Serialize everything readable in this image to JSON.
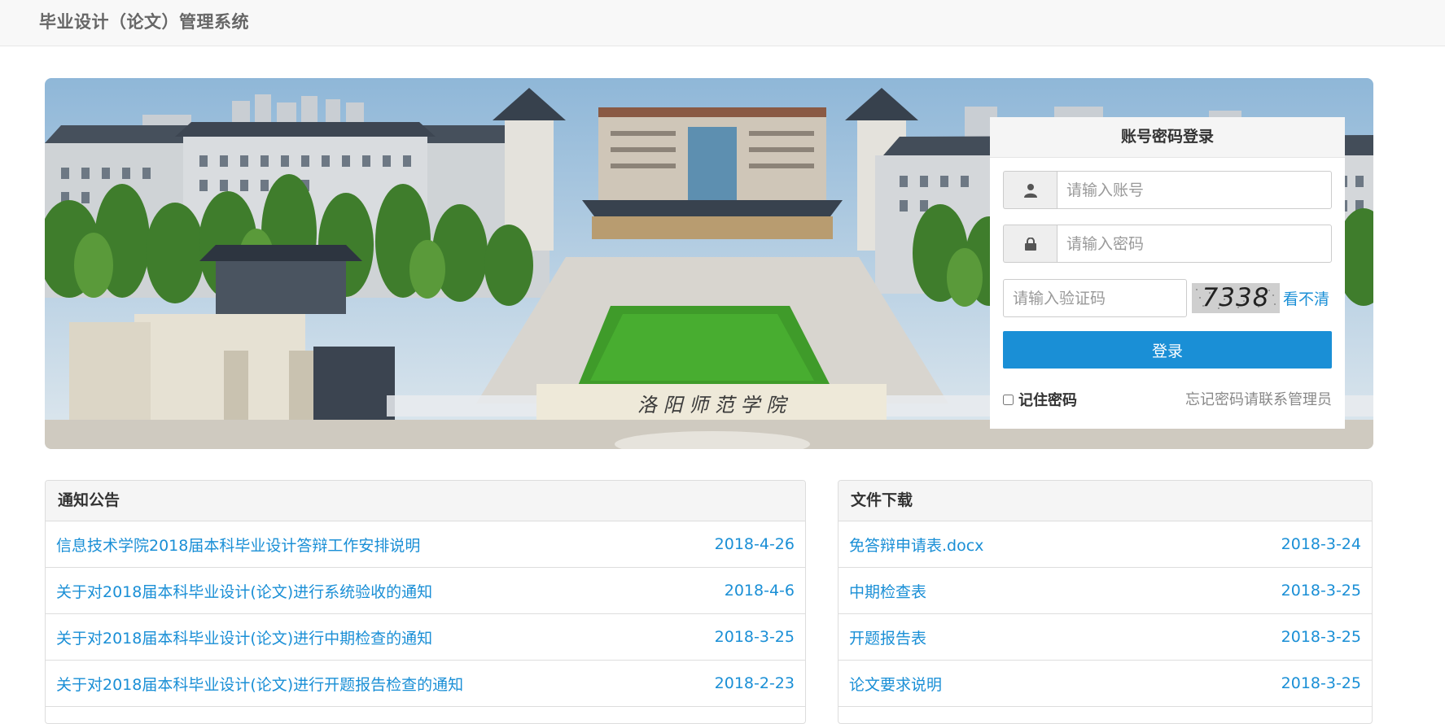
{
  "header": {
    "title": "毕业设计（论文）管理系统"
  },
  "banner": {
    "gate_inscription": "洛 阳 师 范 学 院"
  },
  "login": {
    "title": "账号密码登录",
    "username_placeholder": "请输入账号",
    "password_placeholder": "请输入密码",
    "captcha_placeholder": "请输入验证码",
    "captcha_code": "7338",
    "refresh_label": "看不清",
    "submit_label": "登录",
    "remember_label": "记住密码",
    "forgot_text": "忘记密码请联系管理员",
    "icons": {
      "user": "user-icon",
      "password": "lock-icon"
    }
  },
  "notices": {
    "title": "通知公告",
    "items": [
      {
        "title": "信息技术学院2018届本科毕业设计答辩工作安排说明",
        "date": "2018-4-26"
      },
      {
        "title": "关于对2018届本科毕业设计(论文)进行系统验收的通知",
        "date": "2018-4-6"
      },
      {
        "title": "关于对2018届本科毕业设计(论文)进行中期检查的通知",
        "date": "2018-3-25"
      },
      {
        "title": "关于对2018届本科毕业设计(论文)进行开题报告检查的通知",
        "date": "2018-2-23"
      }
    ]
  },
  "downloads": {
    "title": "文件下载",
    "items": [
      {
        "title": "免答辩申请表.docx",
        "date": "2018-3-24"
      },
      {
        "title": "中期检查表",
        "date": "2018-3-25"
      },
      {
        "title": "开题报告表",
        "date": "2018-3-25"
      },
      {
        "title": "论文要求说明",
        "date": "2018-3-25"
      }
    ]
  },
  "colors": {
    "accent": "#1a8fd6",
    "header_bg": "#f8f8f8",
    "panel_head_bg": "#f5f5f5"
  }
}
